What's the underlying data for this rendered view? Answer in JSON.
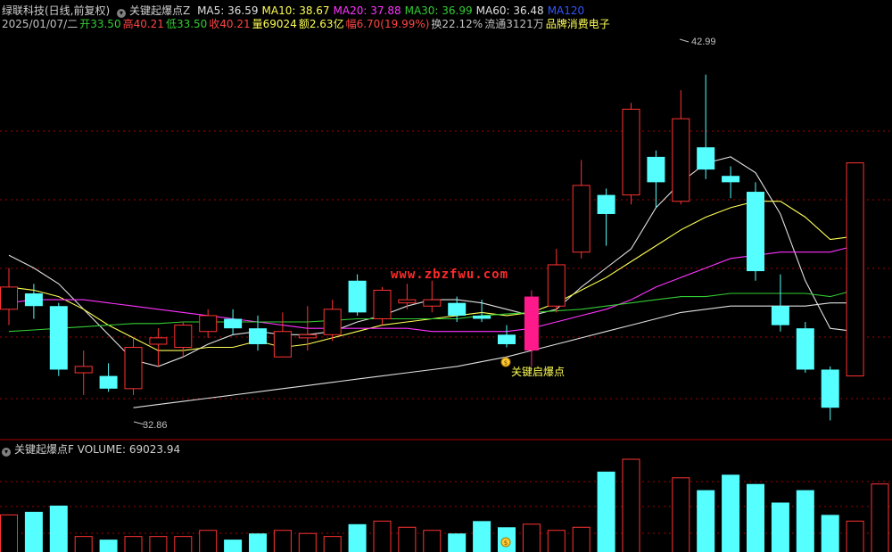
{
  "stock_title": "绿联科技(日线,前复权)",
  "indicator_main": "关键起爆点Z",
  "ma_labels": [
    {
      "text": "MA5: 36.59",
      "color": "#e0e0e0"
    },
    {
      "text": "MA10: 38.67",
      "color": "#ffff55"
    },
    {
      "text": "MA20: 37.88",
      "color": "#ff33ff"
    },
    {
      "text": "MA30: 36.99",
      "color": "#33cc33"
    },
    {
      "text": "MA60: 36.48",
      "color": "#e0e0e0"
    },
    {
      "text": "MA120",
      "color": "#3355ff"
    }
  ],
  "info_row": [
    {
      "text": "2025/01/07/二",
      "color": "#c0c0c0"
    },
    {
      "text": "开33.50",
      "color": "#33cc33"
    },
    {
      "text": "高40.21",
      "color": "#ff4444"
    },
    {
      "text": "低33.50",
      "color": "#33cc33"
    },
    {
      "text": "收40.21",
      "color": "#ff4444"
    },
    {
      "text": "量69024",
      "color": "#ffff55"
    },
    {
      "text": "额2.63亿",
      "color": "#ffff55"
    },
    {
      "text": "幅6.70(19.99%)",
      "color": "#ff4444"
    },
    {
      "text": "换22.12%",
      "color": "#c0c0c0"
    },
    {
      "text": "流通3121万",
      "color": "#c0c0c0"
    },
    {
      "text": "品牌消费电子",
      "color": "#ffff55"
    }
  ],
  "signal_label": "关键启爆点",
  "signal_icon": "money-bag-icon",
  "high_marker": "42.99",
  "low_marker": "32.86",
  "watermark": "www.zbzfwu.com",
  "volume_title": "关键起爆点F VOLUME: 69023.94",
  "colors": {
    "up": "#ff3333",
    "down": "#55ffff",
    "signal": "#ff1a8c",
    "grid": "#aa0000",
    "bg": "#000000"
  },
  "chart_data": {
    "type": "candlestick",
    "price_range": [
      32.0,
      44.3
    ],
    "candles": [
      {
        "o": 35.6,
        "c": 36.3,
        "h": 36.9,
        "l": 35.1
      },
      {
        "o": 36.1,
        "c": 35.7,
        "h": 36.4,
        "l": 35.3
      },
      {
        "o": 35.7,
        "c": 33.7,
        "h": 35.8,
        "l": 33.5
      },
      {
        "o": 33.6,
        "c": 33.8,
        "h": 34.3,
        "l": 32.9
      },
      {
        "o": 33.5,
        "c": 33.1,
        "h": 33.9,
        "l": 33.0
      },
      {
        "o": 33.1,
        "c": 34.4,
        "h": 34.7,
        "l": 32.9
      },
      {
        "o": 34.5,
        "c": 34.7,
        "h": 35.0,
        "l": 33.8
      },
      {
        "o": 34.4,
        "c": 35.1,
        "h": 35.2,
        "l": 34.1
      },
      {
        "o": 34.9,
        "c": 35.4,
        "h": 35.6,
        "l": 34.7
      },
      {
        "o": 35.3,
        "c": 35.0,
        "h": 35.6,
        "l": 34.8
      },
      {
        "o": 35.0,
        "c": 34.5,
        "h": 35.4,
        "l": 34.3
      },
      {
        "o": 34.1,
        "c": 34.9,
        "h": 35.5,
        "l": 34.1
      },
      {
        "o": 34.7,
        "c": 34.8,
        "h": 35.7,
        "l": 34.3
      },
      {
        "o": 34.8,
        "c": 35.6,
        "h": 35.9,
        "l": 34.6
      },
      {
        "o": 36.5,
        "c": 35.5,
        "h": 36.7,
        "l": 35.4
      },
      {
        "o": 35.3,
        "c": 36.2,
        "h": 36.3,
        "l": 35.1
      },
      {
        "o": 35.8,
        "c": 35.9,
        "h": 36.4,
        "l": 35.6
      },
      {
        "o": 35.7,
        "c": 35.9,
        "h": 36.5,
        "l": 35.5
      },
      {
        "o": 35.8,
        "c": 35.4,
        "h": 36.0,
        "l": 35.2
      },
      {
        "o": 35.4,
        "c": 35.3,
        "h": 35.9,
        "l": 35.2
      },
      {
        "o": 34.8,
        "c": 34.5,
        "h": 35.1,
        "l": 34.4
      },
      {
        "o": 34.3,
        "c": 36.0,
        "h": 36.2,
        "l": 33.8,
        "signal": true
      },
      {
        "o": 35.7,
        "c": 37.0,
        "h": 37.5,
        "l": 35.5
      },
      {
        "o": 37.4,
        "c": 39.5,
        "h": 40.3,
        "l": 37.2
      },
      {
        "o": 39.2,
        "c": 38.6,
        "h": 39.4,
        "l": 37.6
      },
      {
        "o": 39.2,
        "c": 41.9,
        "h": 42.1,
        "l": 38.9
      },
      {
        "o": 40.4,
        "c": 39.6,
        "h": 40.6,
        "l": 38.8
      },
      {
        "o": 39.0,
        "c": 41.6,
        "h": 42.5,
        "l": 38.9
      },
      {
        "o": 40.7,
        "c": 40.0,
        "h": 42.99,
        "l": 39.7
      },
      {
        "o": 39.8,
        "c": 39.6,
        "h": 40.1,
        "l": 39.1
      },
      {
        "o": 39.3,
        "c": 36.8,
        "h": 39.6,
        "l": 36.5
      },
      {
        "o": 35.7,
        "c": 35.1,
        "h": 36.7,
        "l": 34.9
      },
      {
        "o": 35.0,
        "c": 33.7,
        "h": 35.2,
        "l": 33.6
      },
      {
        "o": 33.7,
        "c": 32.5,
        "h": 33.8,
        "l": 32.1
      },
      {
        "o": 33.5,
        "c": 40.21,
        "h": 40.21,
        "l": 33.5
      }
    ],
    "ma_series": [
      {
        "name": "MA5",
        "color": "#e0e0e0",
        "values": [
          37.3,
          36.9,
          36.4,
          35.6,
          34.8,
          34.0,
          33.8,
          34.1,
          34.5,
          34.8,
          34.9,
          34.8,
          34.8,
          34.9,
          35.2,
          35.4,
          35.7,
          35.9,
          35.9,
          35.8,
          35.6,
          35.4,
          35.6,
          36.3,
          36.9,
          37.5,
          38.8,
          39.6,
          40.2,
          40.4,
          39.9,
          38.6,
          36.5,
          35.0,
          34.9
        ]
      },
      {
        "name": "MA10",
        "color": "#ffff55",
        "values": [
          36.3,
          36.2,
          36.0,
          35.6,
          35.1,
          34.7,
          34.3,
          34.3,
          34.4,
          34.4,
          34.6,
          34.4,
          34.5,
          34.7,
          34.9,
          35.1,
          35.2,
          35.3,
          35.4,
          35.5,
          35.4,
          35.5,
          35.8,
          36.2,
          36.6,
          37.1,
          37.6,
          38.1,
          38.5,
          38.8,
          39.0,
          39.0,
          38.5,
          37.8,
          37.9
        ]
      },
      {
        "name": "MA20",
        "color": "#ff33ff",
        "values": [
          35.8,
          35.9,
          35.9,
          35.9,
          35.8,
          35.7,
          35.6,
          35.5,
          35.4,
          35.3,
          35.2,
          35.1,
          35.0,
          35.0,
          35.0,
          35.0,
          35.0,
          34.9,
          34.9,
          34.9,
          34.9,
          35.0,
          35.2,
          35.4,
          35.6,
          35.9,
          36.3,
          36.6,
          36.9,
          37.2,
          37.3,
          37.4,
          37.4,
          37.4,
          37.6
        ]
      },
      {
        "name": "MA30",
        "color": "#33cc33",
        "values": [
          34.9,
          34.95,
          35.0,
          35.05,
          35.1,
          35.15,
          35.15,
          35.2,
          35.2,
          35.2,
          35.2,
          35.2,
          35.2,
          35.25,
          35.3,
          35.3,
          35.3,
          35.3,
          35.3,
          35.4,
          35.45,
          35.5,
          35.55,
          35.6,
          35.7,
          35.8,
          35.9,
          36.0,
          36.0,
          36.1,
          36.1,
          36.1,
          36.1,
          36.0,
          36.2
        ]
      },
      {
        "name": "MA60",
        "color": "#e0e0e0",
        "values": [
          null,
          null,
          null,
          null,
          null,
          32.5,
          32.6,
          32.7,
          32.8,
          32.9,
          33.0,
          33.1,
          33.2,
          33.3,
          33.4,
          33.5,
          33.6,
          33.7,
          33.8,
          33.95,
          34.1,
          34.3,
          34.5,
          34.7,
          34.9,
          35.1,
          35.3,
          35.5,
          35.6,
          35.7,
          35.7,
          35.7,
          35.7,
          35.8,
          35.8
        ]
      }
    ],
    "volume": [
      1.2,
      1.3,
      1.5,
      0.5,
      0.4,
      0.5,
      0.5,
      0.5,
      0.7,
      0.4,
      0.6,
      0.7,
      0.6,
      0.5,
      0.9,
      1.0,
      0.8,
      0.7,
      0.6,
      1.0,
      0.8,
      0.9,
      0.7,
      0.8,
      2.6,
      3.0,
      0.0,
      2.4,
      2.0,
      2.5,
      2.2,
      1.6,
      2.0,
      1.2,
      1.0,
      2.2
    ]
  }
}
